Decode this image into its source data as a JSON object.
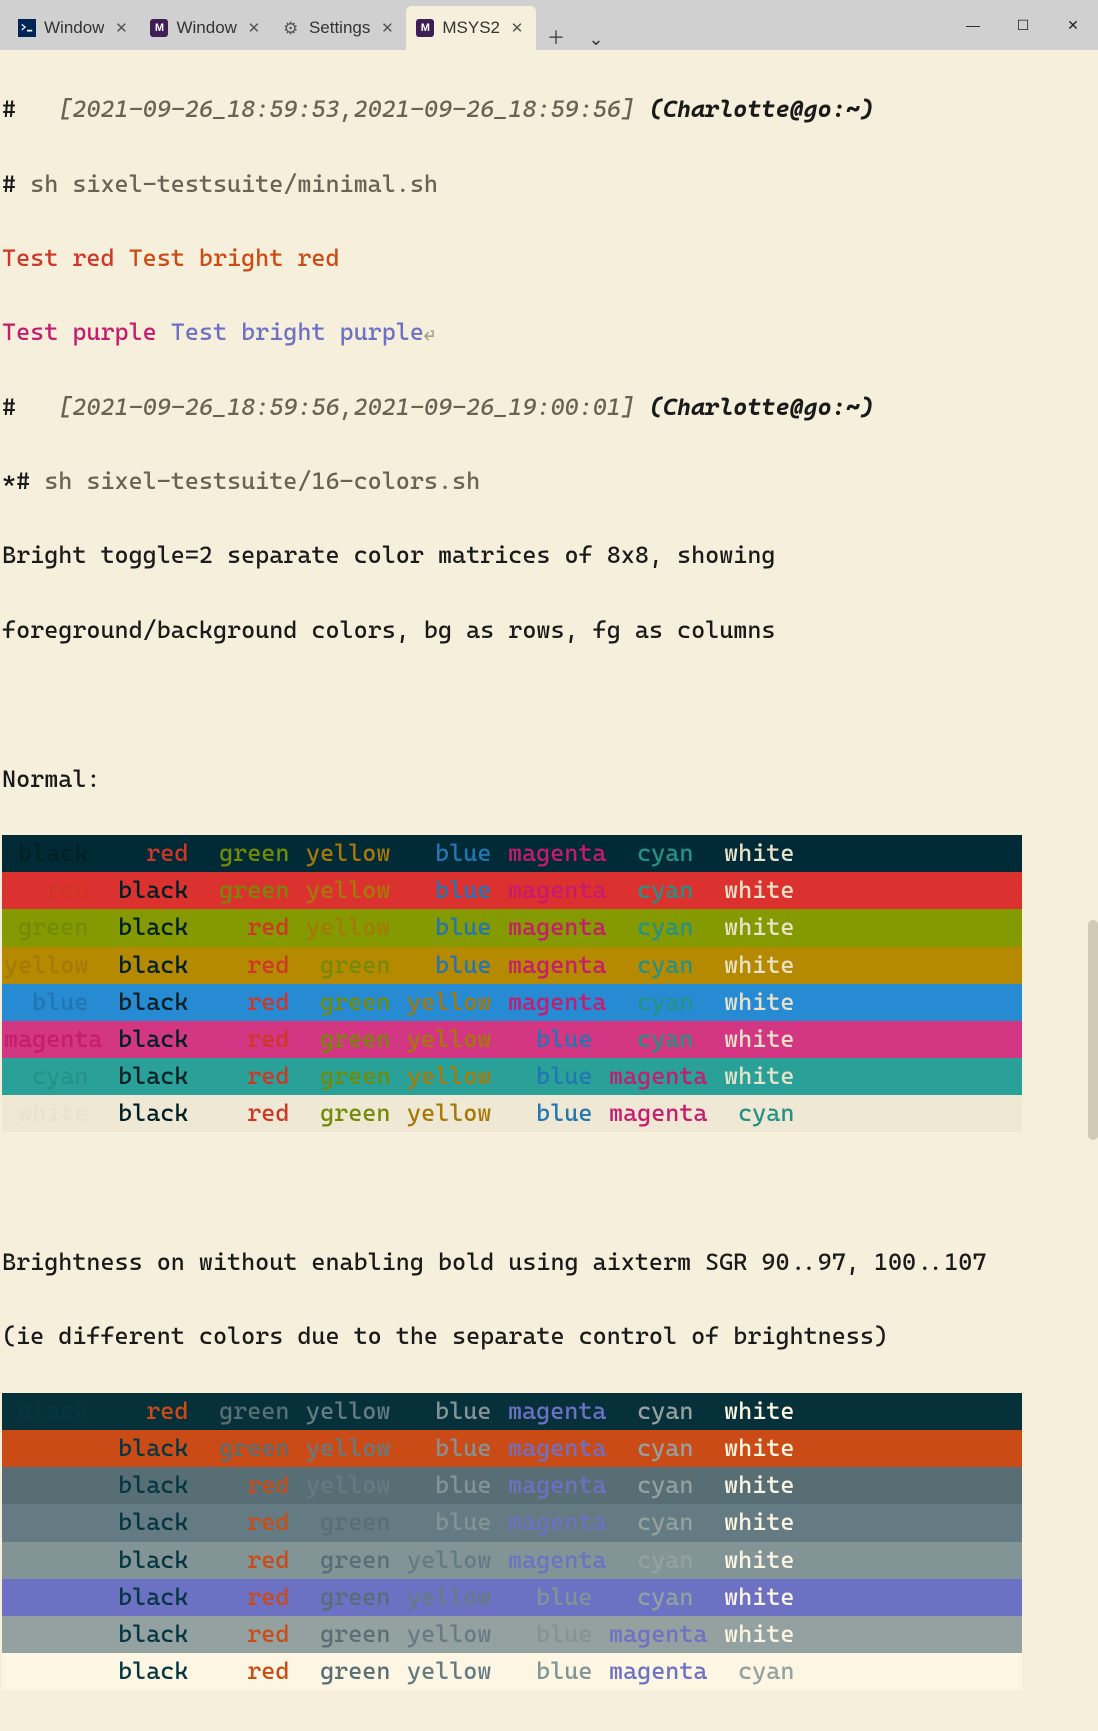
{
  "window": {
    "tabs": [
      {
        "icon": "ps",
        "label": "Window"
      },
      {
        "icon": "msys",
        "label": "Window"
      },
      {
        "icon": "gear",
        "label": "Settings"
      },
      {
        "icon": "msys",
        "label": "MSYS2",
        "active": true
      }
    ],
    "controls": {
      "minimize": "—",
      "maximize": "☐",
      "close": "✕"
    },
    "newtab": "＋",
    "dropdown": "⌄"
  },
  "term": {
    "prompt_hash": "#",
    "ts1": "[2021-09-26_18:59:53,2021-09-26_18:59:56]",
    "userhost1": "(Charlotte@go:~)",
    "cmd1": "sh sixel-testsuite/minimal.sh",
    "test_red": "Test red",
    "test_brred": "Test bright red",
    "test_purple": "Test purple",
    "test_brpurple": "Test bright purple",
    "ts2": "[2021-09-26_18:59:56,2021-09-26_19:00:01]",
    "userhost2": "(Charlotte@go:~)",
    "star_hash": "*#",
    "cmd2": "sh sixel-testsuite/16-colors.sh",
    "desc_l1": "Bright toggle=2 separate color matrices of 8x8, showing",
    "desc_l2": "foreground/background colors, bg as rows, fg as columns",
    "normal_hdr": "Normal:",
    "bright_hdr1": "Brightness on without enabling bold using aixterm SGR 90..97, 100..107",
    "bright_hdr2": "(ie different colors due to the separate control of brightness)"
  },
  "color_names": [
    "black",
    "red",
    "green",
    "yellow",
    "blue",
    "magenta",
    "cyan",
    "white"
  ],
  "pad": {
    "black": " black  ",
    "red": "   red  ",
    "green": " green  ",
    "yellow": "yellow  ",
    "blue": "  blue  ",
    "magenta": "magenta",
    "cyan": "  cyan  ",
    "white": " white "
  }
}
